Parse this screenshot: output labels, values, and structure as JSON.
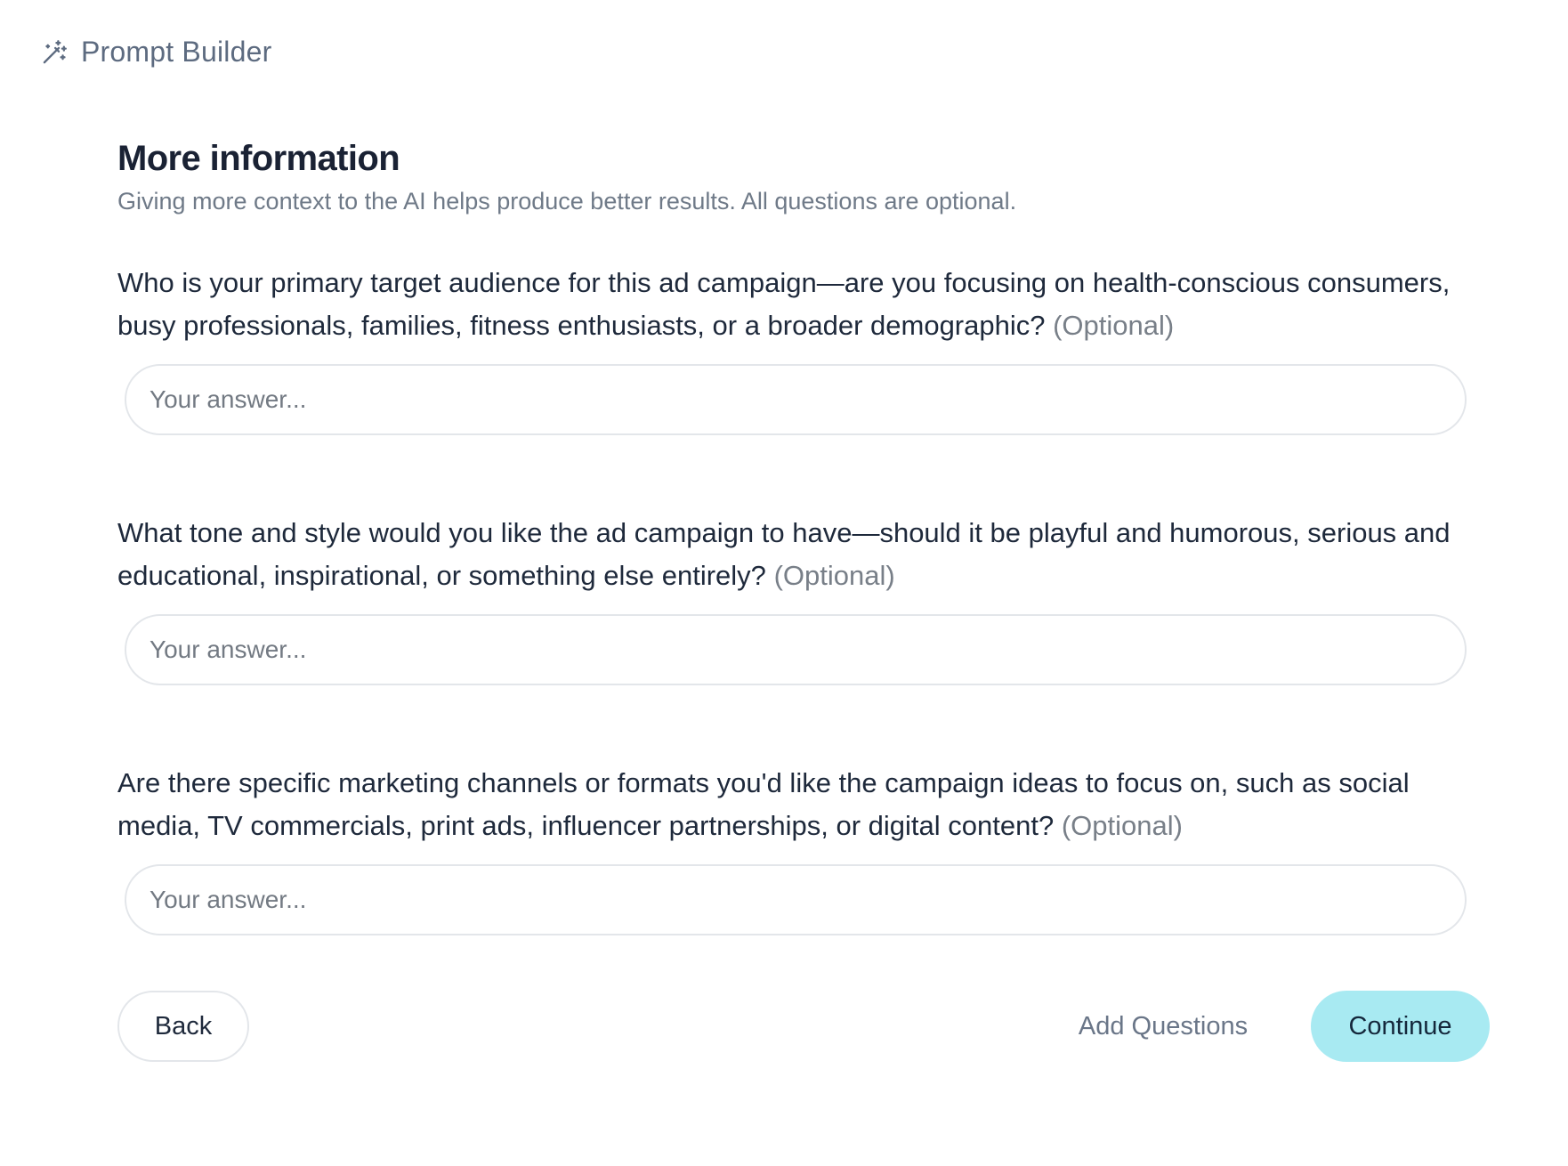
{
  "app": {
    "title": "Prompt Builder",
    "icon": "magic-wand-icon"
  },
  "page": {
    "title": "More information",
    "subtitle": "Giving more context to the AI helps produce better results. All questions are optional."
  },
  "questions": [
    {
      "text": "Who is your primary target audience for this ad campaign—are you focusing on health-conscious consumers, busy professionals, families, fitness enthusiasts, or a broader demographic?",
      "optional_label": "(Optional)",
      "value": "",
      "placeholder": "Your answer..."
    },
    {
      "text": "What tone and style would you like the ad campaign to have—should it be playful and humorous, serious and educational, inspirational, or something else entirely?",
      "optional_label": "(Optional)",
      "value": "",
      "placeholder": "Your answer..."
    },
    {
      "text": "Are there specific marketing channels or formats you'd like the campaign ideas to focus on, such as social media, TV commercials, print ads, influencer partnerships, or digital content?",
      "optional_label": "(Optional)",
      "value": "",
      "placeholder": "Your answer..."
    }
  ],
  "footer": {
    "back_label": "Back",
    "add_questions_label": "Add Questions",
    "continue_label": "Continue"
  },
  "colors": {
    "continue_bg": "#a8eaf2",
    "heading_text": "#1a2234",
    "muted_text": "#6f7a88",
    "input_border": "#e3e6ea"
  }
}
